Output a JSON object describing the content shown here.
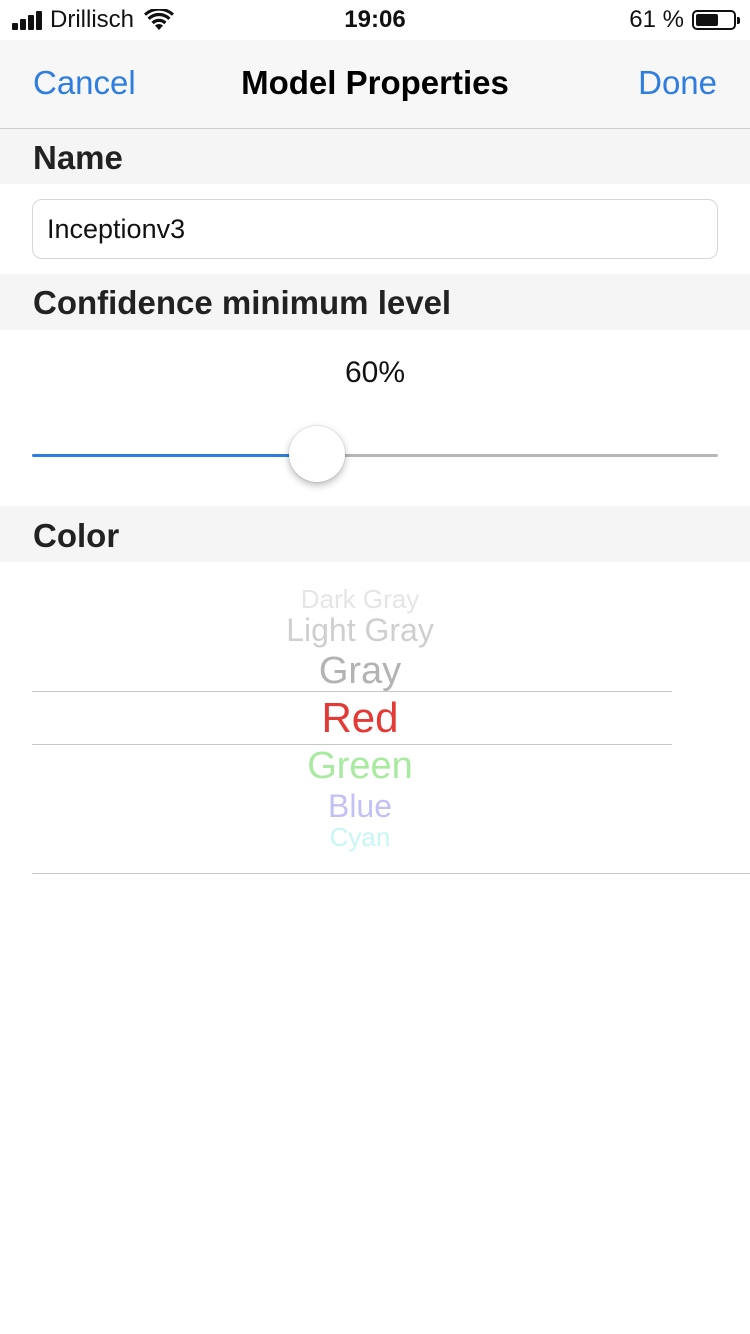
{
  "status_bar": {
    "carrier": "Drillisch",
    "time": "19:06",
    "battery_percent": "61 %",
    "battery_level": 0.61,
    "icons": [
      "signal-icon",
      "wifi-icon",
      "battery-icon"
    ]
  },
  "nav": {
    "cancel_label": "Cancel",
    "title": "Model Properties",
    "done_label": "Done"
  },
  "name_section": {
    "header": "Name",
    "value": "Inceptionv3"
  },
  "confidence_section": {
    "header": "Confidence minimum level",
    "value_text": "60%",
    "value": 0.6
  },
  "color_section": {
    "header": "Color",
    "options": [
      "Dark Gray",
      "Light Gray",
      "Gray",
      "Red",
      "Green",
      "Blue",
      "Cyan"
    ],
    "selected": "Red"
  },
  "colors": {
    "accent": "#2f7de1",
    "selected_option": "#e53935",
    "header_background": "#f5f5f5"
  }
}
